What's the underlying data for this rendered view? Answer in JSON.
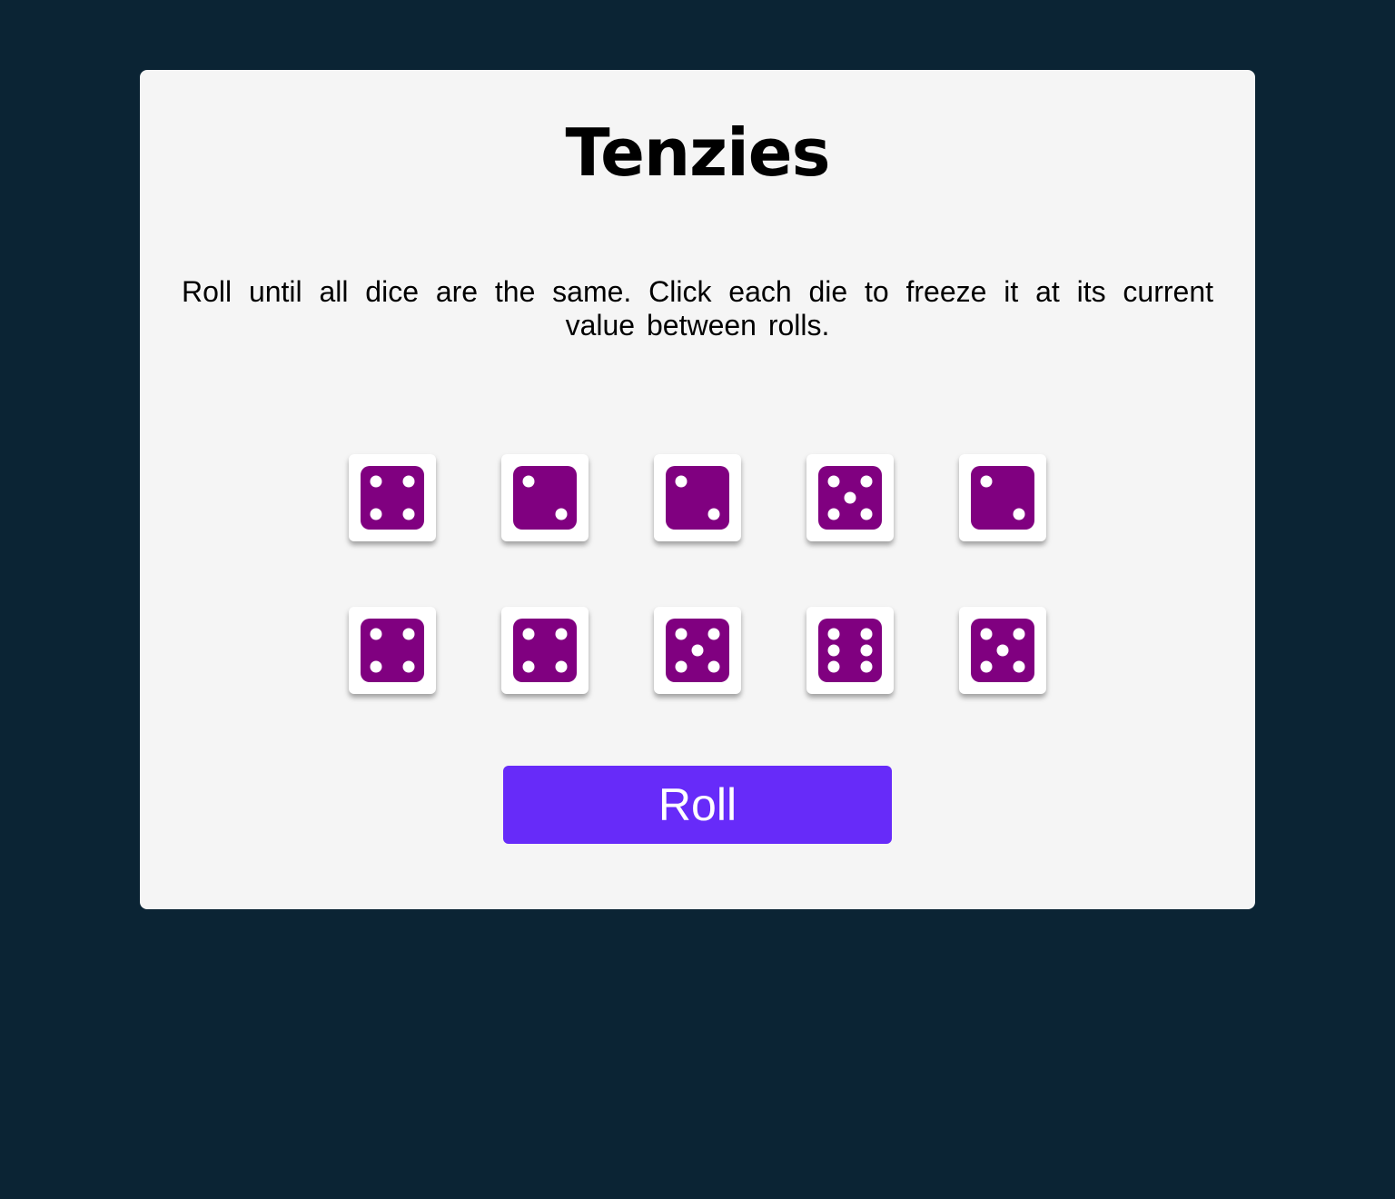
{
  "app": {
    "title": "Tenzies",
    "instructions": "Roll until all dice are the same. Click each die to freeze it at its current value between rolls."
  },
  "dice": [
    {
      "value": 4,
      "held": false
    },
    {
      "value": 2,
      "held": false
    },
    {
      "value": 2,
      "held": false
    },
    {
      "value": 5,
      "held": false
    },
    {
      "value": 2,
      "held": false
    },
    {
      "value": 4,
      "held": false
    },
    {
      "value": 4,
      "held": false
    },
    {
      "value": 5,
      "held": false
    },
    {
      "value": 6,
      "held": false
    },
    {
      "value": 5,
      "held": false
    }
  ],
  "controls": {
    "roll_label": "Roll"
  },
  "colors": {
    "background": "#0b2434",
    "card": "#f5f5f5",
    "die_face": "#800080",
    "die_pip": "#ffffff",
    "die_tile": "#ffffff",
    "button": "#672bf9",
    "button_text": "#ffffff"
  },
  "icons": {
    "die_face": "dice-face-icon"
  }
}
